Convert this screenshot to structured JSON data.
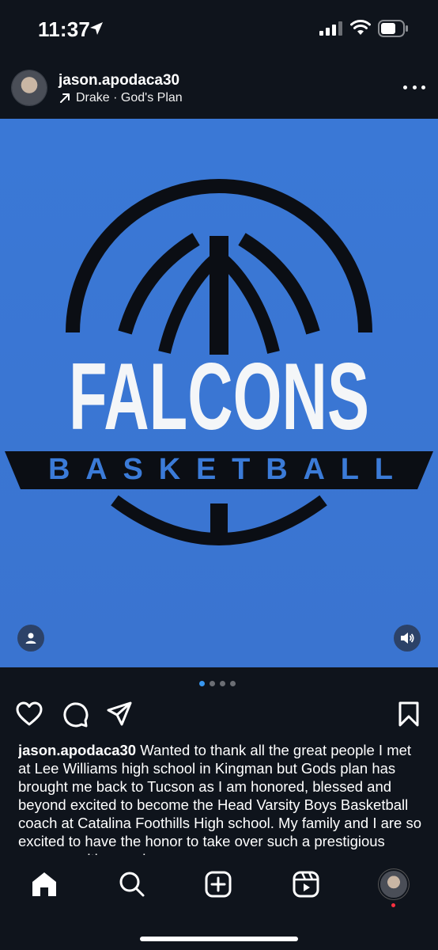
{
  "status_bar": {
    "time": "11:37"
  },
  "post": {
    "username": "jason.apodaca30",
    "music": "Drake · God's Plan",
    "media": {
      "logo_title": "FALCONS",
      "logo_subtitle": "BASKETBALL",
      "background_color": "#3a76d4",
      "carousel_total": 4,
      "carousel_active": 1
    },
    "caption_username": "jason.apodaca30",
    "caption_text": "Wanted to thank all the great people I met at Lee Williams high school in Kingman but Gods plan has brought me back to Tucson as I am honored, blessed and beyond excited to become the Head Varsity Boys Basketball coach at Catalina Foothills High school. My family and I are so excited to have the honor to take over such a prestigious program with amazing"
  },
  "icons": {
    "more": "more-options-icon",
    "like": "heart-icon",
    "comment": "comment-icon",
    "share": "send-icon",
    "save": "bookmark-icon",
    "home": "home-icon",
    "search": "search-icon",
    "create": "create-icon",
    "reels": "reels-icon"
  },
  "colors": {
    "background": "#0f141c",
    "accent_dot": "#3897f0",
    "notification": "#ff3040"
  }
}
